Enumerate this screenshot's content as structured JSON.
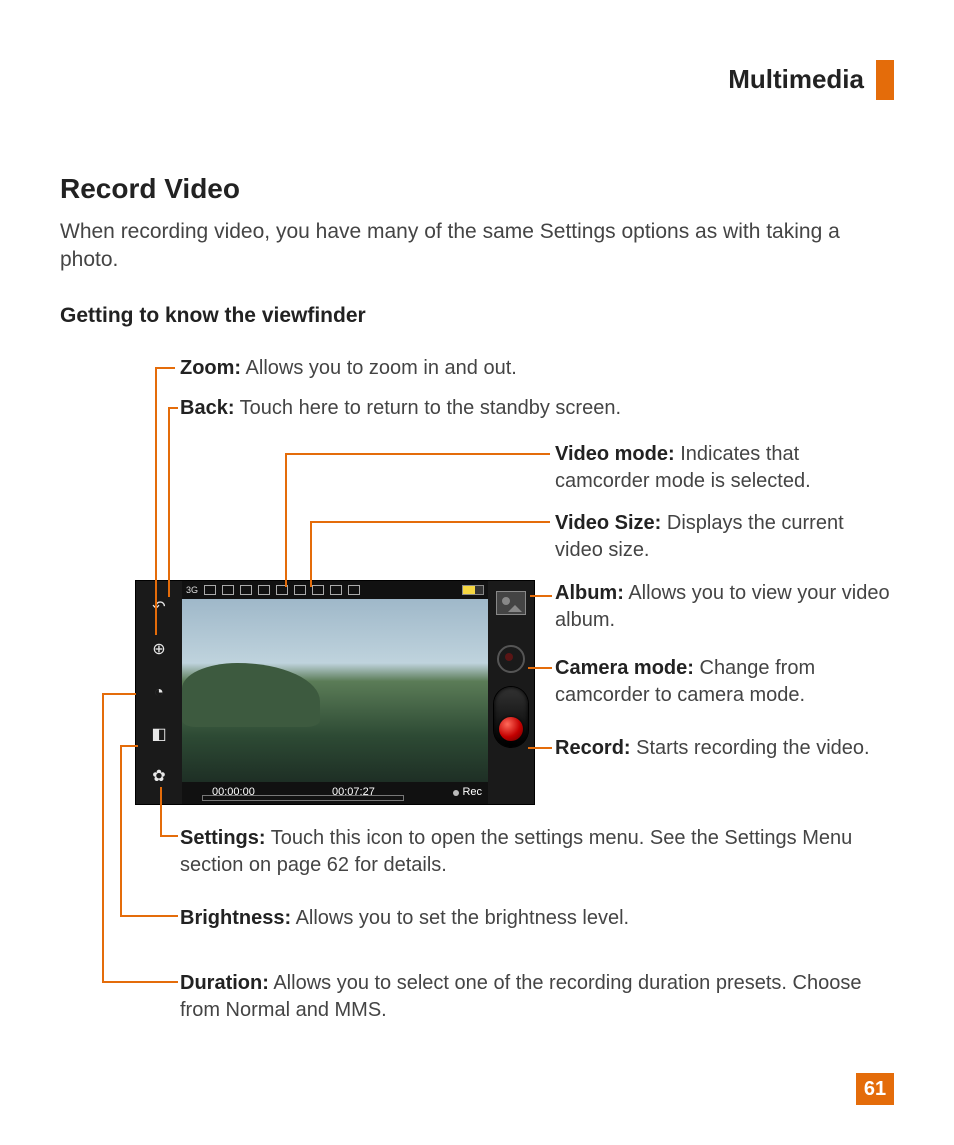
{
  "header": {
    "section": "Multimedia"
  },
  "title": "Record Video",
  "intro": "When recording video, you have many of the same Settings options as with taking a photo.",
  "subheading": "Getting to know the viewfinder",
  "callouts": {
    "zoom": {
      "label": "Zoom:",
      "text": " Allows you to zoom in and out."
    },
    "back": {
      "label": "Back:",
      "text": " Touch here to return to the standby screen."
    },
    "video_mode": {
      "label": "Video mode:",
      "text": " Indicates that camcorder mode is selected."
    },
    "video_size": {
      "label": "Video Size:",
      "text": " Displays the current video size."
    },
    "album": {
      "label": "Album:",
      "text": " Allows you to view your video album."
    },
    "camera_mode": {
      "label": "Camera mode:",
      "text": " Change from camcorder to camera mode."
    },
    "record": {
      "label": "Record:",
      "text": " Starts recording the video."
    },
    "settings": {
      "label": "Settings:",
      "text": " Touch this icon to open the settings menu. See the Settings Menu section on page 62 for details."
    },
    "brightness": {
      "label": "Brightness:",
      "text": " Allows you to set the brightness level."
    },
    "duration": {
      "label": "Duration:",
      "text": " Allows you to select one of the recording duration presets. Choose from Normal and MMS."
    }
  },
  "viewfinder": {
    "elapsed": "00:00:00",
    "remaining": "00:07:27",
    "rec_label": "Rec",
    "status_3g": "3G"
  },
  "page_number": "61"
}
